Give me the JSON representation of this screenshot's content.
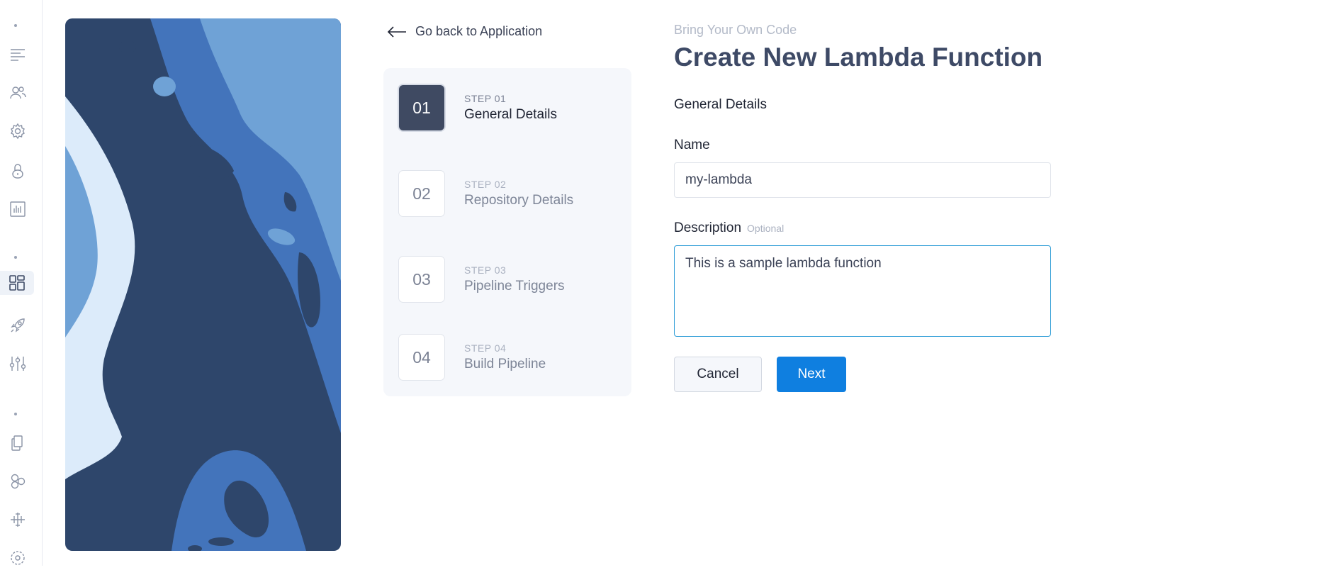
{
  "sidebar": {
    "icons": [
      "menu-icon",
      "users-icon",
      "settings-gear-icon",
      "lock-icon",
      "bar-chart-icon",
      "applications-grid-icon",
      "rocket-icon",
      "sliders-icon",
      "documents-icon",
      "hexagons-icon",
      "integrations-icon",
      "target-icon"
    ],
    "active": "applications-grid-icon"
  },
  "back_link": {
    "label": "Go back to Application"
  },
  "stepper": {
    "steps": [
      {
        "number": "01",
        "kicker": "STEP 01",
        "title": "General Details",
        "active": true
      },
      {
        "number": "02",
        "kicker": "STEP 02",
        "title": "Repository Details",
        "active": false
      },
      {
        "number": "03",
        "kicker": "STEP 03",
        "title": "Pipeline Triggers",
        "active": false
      },
      {
        "number": "04",
        "kicker": "STEP 04",
        "title": "Build Pipeline",
        "active": false
      }
    ]
  },
  "form": {
    "eyebrow": "Bring Your Own Code",
    "title": "Create New Lambda Function",
    "section_title": "General Details",
    "name_label": "Name",
    "name_value": "my-lambda",
    "description_label": "Description",
    "description_optional": "Optional",
    "description_value": "This is a sample lambda function",
    "cancel_label": "Cancel",
    "next_label": "Next"
  },
  "colors": {
    "primary": "#0f7fe0",
    "active_step": "#3f4a62",
    "focus_border": "#2b9bd6",
    "art_dark": "#2e466b",
    "art_mid": "#4374bb",
    "art_light": "#6fa2d6",
    "art_pale": "#dcebfa"
  }
}
